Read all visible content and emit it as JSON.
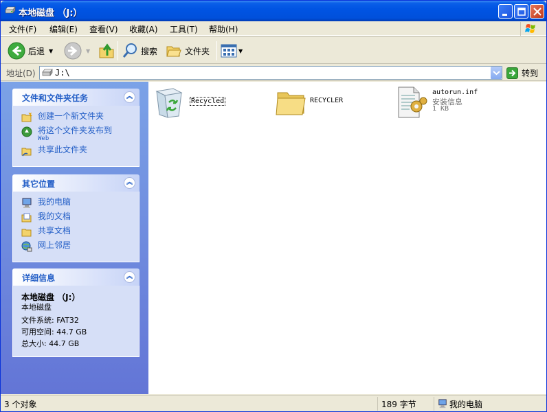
{
  "window": {
    "title": "本地磁盘 （J:）"
  },
  "menu": [
    "文件(F)",
    "编辑(E)",
    "查看(V)",
    "收藏(A)",
    "工具(T)",
    "帮助(H)"
  ],
  "toolbar": {
    "back": "后退",
    "search": "搜索",
    "folders": "文件夹"
  },
  "address": {
    "label": "地址(D)",
    "value": "J:\\",
    "go": "转到"
  },
  "tasks_panel": {
    "title": "文件和文件夹任务",
    "items": [
      {
        "label": "创建一个新文件夹",
        "icon": "new-folder-icon"
      },
      {
        "label": "将这个文件夹发布到",
        "sub": "Web",
        "icon": "publish-web-icon"
      },
      {
        "label": "共享此文件夹",
        "icon": "share-folder-icon"
      }
    ]
  },
  "places_panel": {
    "title": "其它位置",
    "items": [
      {
        "label": "我的电脑",
        "icon": "my-computer-icon"
      },
      {
        "label": "我的文档",
        "icon": "my-documents-icon"
      },
      {
        "label": "共享文档",
        "icon": "shared-documents-icon"
      },
      {
        "label": "网上邻居",
        "icon": "network-icon"
      }
    ]
  },
  "details_panel": {
    "title": "详细信息",
    "name": "本地磁盘 （J:）",
    "type": "本地磁盘",
    "filesystem": "文件系统: FAT32",
    "free": "可用空间: 44.7 GB",
    "total": "总大小: 44.7 GB"
  },
  "files": [
    {
      "name": "Recycled",
      "icon": "recycle-bin-icon"
    },
    {
      "name": "RECYCLER",
      "icon": "folder-icon"
    },
    {
      "name": "autorun.inf",
      "type": "安装信息",
      "size": "1 KB",
      "icon": "setup-info-icon"
    }
  ],
  "status": {
    "count": "3 个对象",
    "size": "189 字节",
    "location": "我的电脑"
  },
  "colors": {
    "titlebar": "#0054e3",
    "task_link": "#215dc6",
    "pane": "#6375d6"
  }
}
